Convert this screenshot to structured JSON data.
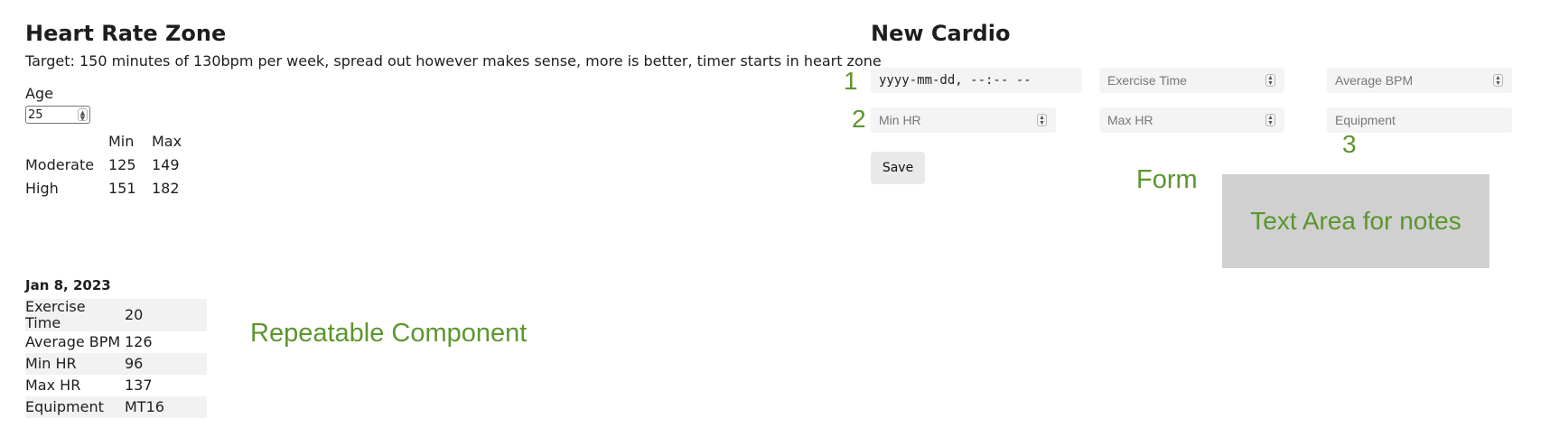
{
  "heart_rate": {
    "title": "Heart Rate Zone",
    "target": "Target: 150 minutes of 130bpm per week, spread out however makes sense, more is better, timer starts in heart zone",
    "age_label": "Age",
    "age_value": "25",
    "table": {
      "headers": [
        "",
        "Min",
        "Max"
      ],
      "rows": [
        {
          "zone": "Moderate",
          "min": "125",
          "max": "149"
        },
        {
          "zone": "High",
          "min": "151",
          "max": "182"
        }
      ]
    }
  },
  "entry": {
    "date": "Jan 8, 2023",
    "rows": [
      {
        "label": "Exercise Time",
        "value": "20"
      },
      {
        "label": "Average BPM",
        "value": "126"
      },
      {
        "label": "Min HR",
        "value": "96"
      },
      {
        "label": "Max HR",
        "value": "137"
      },
      {
        "label": "Equipment",
        "value": "MT16"
      }
    ]
  },
  "annotations": {
    "repeatable": "Repeatable Component",
    "form": "Form",
    "notes": "Text Area for notes",
    "n1": "1",
    "n2": "2",
    "n3": "3"
  },
  "new_cardio": {
    "title": "New Cardio",
    "date_placeholder": "yyyy-mm-dd, --:-- --",
    "exercise_time_placeholder": "Exercise Time",
    "average_bpm_placeholder": "Average BPM",
    "min_hr_placeholder": "Min HR",
    "max_hr_placeholder": "Max HR",
    "equipment_placeholder": "Equipment",
    "save_label": "Save"
  },
  "colors": {
    "annotation": "#5b962e",
    "notes_box": "#d0d0d0",
    "field_bg": "#f4f4f4"
  }
}
